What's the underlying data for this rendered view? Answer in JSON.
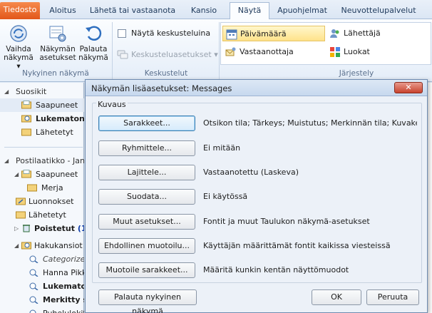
{
  "ribbon_tabs": {
    "file": "Tiedosto",
    "home": "Aloitus",
    "send_receive": "Lähetä tai vastaanota",
    "folder": "Kansio",
    "view": "Näytä",
    "addins": "Apuohjelmat",
    "exchange": "Neuvottelupalvelut"
  },
  "ribbon": {
    "change_view": "Vaihda\nnäkymä ▾",
    "view_settings": "Näkymän\nasetukset",
    "reset_view": "Palauta\nnäkymä",
    "current_view_group": "Nykyinen näkymä",
    "show_conversations": "Näytä keskusteluina",
    "conversation_settings": "Keskusteluasetukset ▾",
    "conversations_group": "Keskustelut",
    "arrange_date": "Päivämäärä",
    "arrange_to": "Vastaanottaja",
    "arrange_from": "Lähettäjä",
    "arrange_categories": "Luokat",
    "arrangement_group": "Järjestely"
  },
  "nav": {
    "favorites": "Suosikit",
    "fav_inbox": "Saapuneet",
    "fav_unread": "Lukematon p",
    "fav_sent": "Lähetetyt",
    "mailbox": "Postilaatikko - Jane",
    "inbox": "Saapuneet",
    "merja": "Merja",
    "drafts": "Luonnokset",
    "sent": "Lähetetyt",
    "deleted": "Poistetut",
    "deleted_count": "(11)",
    "search_folders": "Hakukansiot",
    "categorized": "Categorized",
    "hanna": "Hanna Pikk",
    "unread_mail": "Lukematon",
    "flagged": "Merkitty se",
    "phone": "Puhelulokit"
  },
  "dialog": {
    "title": "Näkymän lisäasetukset: Messages",
    "close": "✕",
    "group_label": "Kuvaus",
    "rows": [
      {
        "button": "Sarakkeet...",
        "desc": "Otsikon tila; Tärkeys; Muistutus; Merkinnän tila; Kuvake; Liit..."
      },
      {
        "button": "Ryhmittele...",
        "desc": "Ei mitään"
      },
      {
        "button": "Lajittele...",
        "desc": "Vastaanotettu (Laskeva)"
      },
      {
        "button": "Suodata...",
        "desc": "Ei käytössä"
      },
      {
        "button": "Muut asetukset...",
        "desc": "Fontit ja muut Taulukon näkymä-asetukset"
      },
      {
        "button": "Ehdollinen muotoilu...",
        "desc": "Käyttäjän määrittämät fontit kaikissa viesteissä"
      },
      {
        "button": "Muotoile sarakkeet...",
        "desc": "Määritä kunkin kentän näyttömuodot"
      }
    ],
    "reset_button": "Palauta nykyinen näkymä",
    "ok_button": "OK",
    "cancel_button": "Peruuta"
  },
  "colors": {
    "accent": "#e2571a",
    "selection": "#ffe28a",
    "unread_count": "#0b3aa8"
  }
}
